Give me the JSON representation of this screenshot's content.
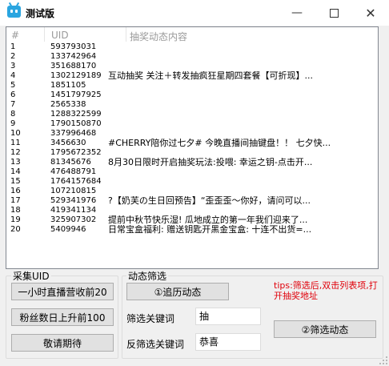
{
  "window": {
    "title": "测试版",
    "minimize_glyph": "—",
    "close_glyph": "✕"
  },
  "listview": {
    "columns": [
      "#",
      "UID",
      "抽奖动态内容"
    ],
    "rows": [
      {
        "n": "1",
        "uid": "593793031",
        "content": ""
      },
      {
        "n": "2",
        "uid": "133742964",
        "content": ""
      },
      {
        "n": "3",
        "uid": "351688170",
        "content": ""
      },
      {
        "n": "4",
        "uid": "1302129189",
        "content": "互动抽奖 关注＋转发抽疯狂星期四套餐【可折现】..."
      },
      {
        "n": "5",
        "uid": "1851105",
        "content": ""
      },
      {
        "n": "6",
        "uid": "1451797925",
        "content": ""
      },
      {
        "n": "7",
        "uid": "2565338",
        "content": ""
      },
      {
        "n": "8",
        "uid": "1288322599",
        "content": ""
      },
      {
        "n": "9",
        "uid": "1790150870",
        "content": ""
      },
      {
        "n": "10",
        "uid": "337996468",
        "content": ""
      },
      {
        "n": "11",
        "uid": "3456630",
        "content": "#CHERRY陪你过七夕# 今晚直播间抽键盘！！ 七夕快..."
      },
      {
        "n": "12",
        "uid": "1795672352",
        "content": ""
      },
      {
        "n": "13",
        "uid": "81345676",
        "content": "8月30日限时开启抽奖玩法:投喂: 幸运之钥-点击开..."
      },
      {
        "n": "14",
        "uid": "476488791",
        "content": ""
      },
      {
        "n": "15",
        "uid": "1764157684",
        "content": ""
      },
      {
        "n": "16",
        "uid": "107210815",
        "content": ""
      },
      {
        "n": "17",
        "uid": "529341976",
        "content": "?【奶芙の生日回预告】“歪歪歪～你好，请问可以..."
      },
      {
        "n": "18",
        "uid": "419341134",
        "content": ""
      },
      {
        "n": "19",
        "uid": "325907302",
        "content": "提前中秋节快乐湿! 瓜地成立的第一年我们迎来了..."
      },
      {
        "n": "20",
        "uid": "5409946",
        "content": "日常宝盒福利: 赠送钥匙开黑金宝盒: 十连不出货=..."
      }
    ]
  },
  "collect": {
    "title": "采集UID",
    "btn_revenue": "一小时直播营收前20",
    "btn_fans": "粉丝数日上升前100",
    "btn_coming": "敬请期待"
  },
  "filter": {
    "title": "动态筛选",
    "btn_trace": "①追历动态",
    "tips": "tips:筛选后,双击列表项,打开抽奖地址",
    "keyword_label": "筛选关键词",
    "keyword_value": "抽",
    "reverse_label": "反筛选关键词",
    "reverse_value": "恭喜",
    "btn_filter": "②筛选动态"
  },
  "colors": {
    "tips": "#e0000a",
    "icon": "#2aa5e0"
  }
}
